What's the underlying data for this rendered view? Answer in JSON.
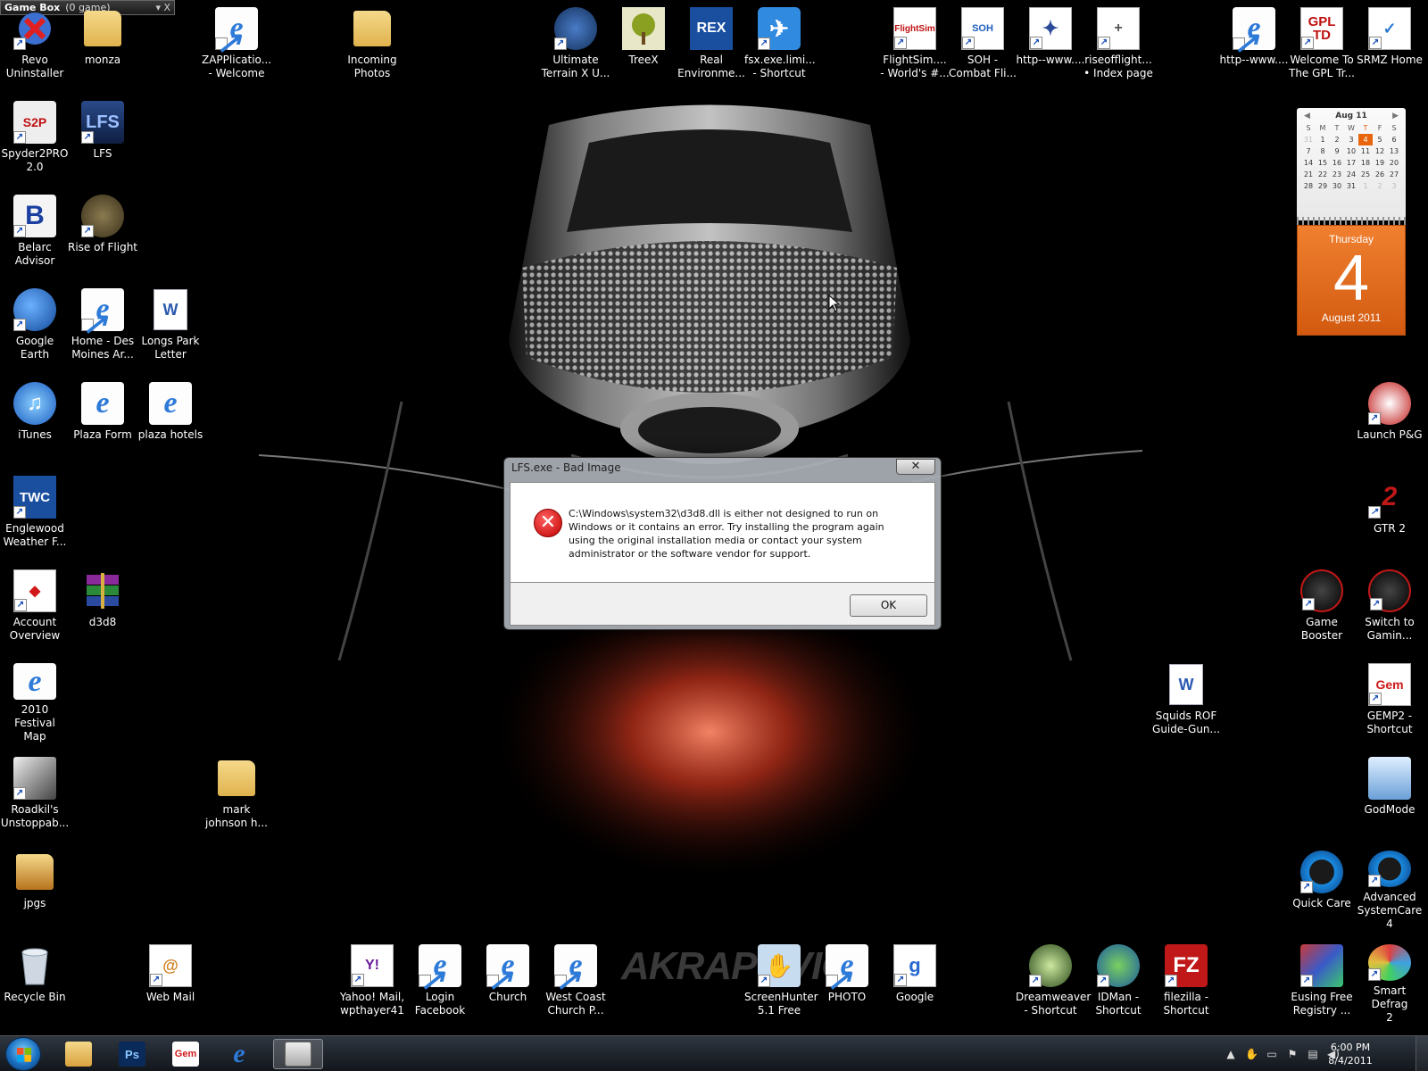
{
  "gamebox": {
    "title": "Game Box",
    "count": "(0 game)",
    "controls": "▾ X"
  },
  "desktop_icons": [
    {
      "label": "Revo\nUninstaller",
      "icon": "revo-uninstaller-icon"
    },
    {
      "label": "monza",
      "icon": "folder-icon"
    },
    {
      "label": "ZAPPlicatio...\n- Welcome",
      "icon": "internet-explorer-icon"
    },
    {
      "label": "Incoming\nPhotos",
      "icon": "folder-icon"
    },
    {
      "label": "Ultimate\nTerrain X U...",
      "icon": "globe-icon"
    },
    {
      "label": "TreeX",
      "icon": "tree-icon"
    },
    {
      "label": "Real\nEnvironme...",
      "icon": "rex-icon"
    },
    {
      "label": "fsx.exe.limi...\n- Shortcut",
      "icon": "airplane-icon"
    },
    {
      "label": "FlightSim....\n- World's #...",
      "icon": "flightsim-icon"
    },
    {
      "label": "SOH -\nCombat Fli...",
      "icon": "soh-icon"
    },
    {
      "label": "http--www....",
      "icon": "web-shortcut-icon"
    },
    {
      "label": "riseofflight...\n• Index page",
      "icon": "web-shortcut-icon"
    },
    {
      "label": "http--www....",
      "icon": "internet-explorer-icon"
    },
    {
      "label": "Welcome To\nThe GPL Tr...",
      "icon": "gpltd-icon"
    },
    {
      "label": "SRMZ Home",
      "icon": "web-shortcut-icon"
    },
    {
      "label": "Spyder2PRO\n2.0",
      "icon": "spyder-icon"
    },
    {
      "label": "LFS",
      "icon": "lfs-icon"
    },
    {
      "label": "Belarc\nAdvisor",
      "icon": "belarc-icon"
    },
    {
      "label": "Rise of Flight",
      "icon": "rise-of-flight-icon"
    },
    {
      "label": "Google Earth",
      "icon": "google-earth-icon"
    },
    {
      "label": "Home - Des\nMoines Ar...",
      "icon": "internet-explorer-icon"
    },
    {
      "label": "Longs Park\nLetter",
      "icon": "word-document-icon"
    },
    {
      "label": "iTunes",
      "icon": "itunes-icon"
    },
    {
      "label": "Plaza Form",
      "icon": "internet-explorer-icon"
    },
    {
      "label": "plaza hotels",
      "icon": "internet-explorer-icon"
    },
    {
      "label": "Englewood\nWeather F...",
      "icon": "twc-icon"
    },
    {
      "label": "Account\nOverview",
      "icon": "bank-icon"
    },
    {
      "label": "d3d8",
      "icon": "winrar-icon"
    },
    {
      "label": "2010 Festival\nMap",
      "icon": "internet-explorer-icon"
    },
    {
      "label": "Roadkil's\nUnstoppab...",
      "icon": "cat-icon"
    },
    {
      "label": "mark\njohnson h...",
      "icon": "folder-icon"
    },
    {
      "label": "jpgs",
      "icon": "folder-icon"
    },
    {
      "label": "Recycle Bin",
      "icon": "recycle-bin-icon"
    },
    {
      "label": "Web Mail",
      "icon": "web-mail-icon"
    },
    {
      "label": "Yahoo! Mail,\nwpthayer41",
      "icon": "yahoo-icon"
    },
    {
      "label": "Login\nFacebook",
      "icon": "internet-explorer-icon"
    },
    {
      "label": "Church",
      "icon": "internet-explorer-icon"
    },
    {
      "label": "West Coast\nChurch P...",
      "icon": "internet-explorer-icon"
    },
    {
      "label": "ScreenHunter\n5.1 Free",
      "icon": "screenhunter-icon"
    },
    {
      "label": "PHOTO",
      "icon": "internet-explorer-icon"
    },
    {
      "label": "Google",
      "icon": "google-icon"
    },
    {
      "label": "Dreamweaver\n- Shortcut",
      "icon": "dreamweaver-icon"
    },
    {
      "label": "IDMan -\nShortcut",
      "icon": "idman-icon"
    },
    {
      "label": "filezilla -\nShortcut",
      "icon": "filezilla-icon"
    },
    {
      "label": "Eusing Free\nRegistry ...",
      "icon": "eusing-icon"
    },
    {
      "label": "Smart Defrag\n2",
      "icon": "smart-defrag-icon"
    },
    {
      "label": "Launch P&G",
      "icon": "launch-pg-icon"
    },
    {
      "label": "GTR 2",
      "icon": "gtr2-icon"
    },
    {
      "label": "Game\nBooster",
      "icon": "game-booster-icon"
    },
    {
      "label": "Switch to\nGamin...",
      "icon": "game-booster-icon"
    },
    {
      "label": "Squids ROF\nGuide-Gun...",
      "icon": "word-document-icon"
    },
    {
      "label": "GEMP2 -\nShortcut",
      "icon": "gem-icon"
    },
    {
      "label": "GodMode",
      "icon": "control-panel-icon"
    },
    {
      "label": "Quick Care",
      "icon": "quick-care-icon"
    },
    {
      "label": "Advanced\nSystemCare 4",
      "icon": "systemcare-icon"
    }
  ],
  "calendar": {
    "month_label": "Aug 11",
    "weekdays": [
      "S",
      "M",
      "T",
      "W",
      "T",
      "F",
      "S"
    ],
    "weeks": [
      [
        "31",
        "1",
        "2",
        "3",
        "4",
        "5",
        "6"
      ],
      [
        "7",
        "8",
        "9",
        "10",
        "11",
        "12",
        "13"
      ],
      [
        "14",
        "15",
        "16",
        "17",
        "18",
        "19",
        "20"
      ],
      [
        "21",
        "22",
        "23",
        "24",
        "25",
        "26",
        "27"
      ],
      [
        "28",
        "29",
        "30",
        "31",
        "1",
        "2",
        "3"
      ]
    ],
    "today": "4",
    "day_of_week": "Thursday",
    "day_number": "4",
    "month_year": "August 2011"
  },
  "dialog": {
    "title": "LFS.exe - Bad Image",
    "close_label": "✕",
    "message": "C:\\Windows\\system32\\d3d8.dll is either not designed to run on Windows or it contains an error. Try installing the program again using the original installation media or contact your system administrator or the software vendor for support.",
    "ok_label": "OK"
  },
  "wallpaper_logo": "AKRAPOVIČ",
  "taskbar": {
    "pinned": [
      {
        "name": "explorer",
        "icon": "folder-icon",
        "active": false
      },
      {
        "name": "photoshop",
        "icon": "photoshop-icon",
        "label": "Ps",
        "active": false
      },
      {
        "name": "gem",
        "icon": "gem-icon",
        "label": "Gem",
        "active": false
      },
      {
        "name": "ie",
        "icon": "internet-explorer-icon",
        "label": "e",
        "active": false
      },
      {
        "name": "window",
        "icon": "window-icon",
        "active": true
      }
    ],
    "clock_time": "6:00 PM",
    "clock_date": "8/4/2011"
  },
  "colors": {
    "accent_orange": "#e8650e",
    "error_red": "#c00000",
    "ie_blue": "#2d7ad8"
  }
}
